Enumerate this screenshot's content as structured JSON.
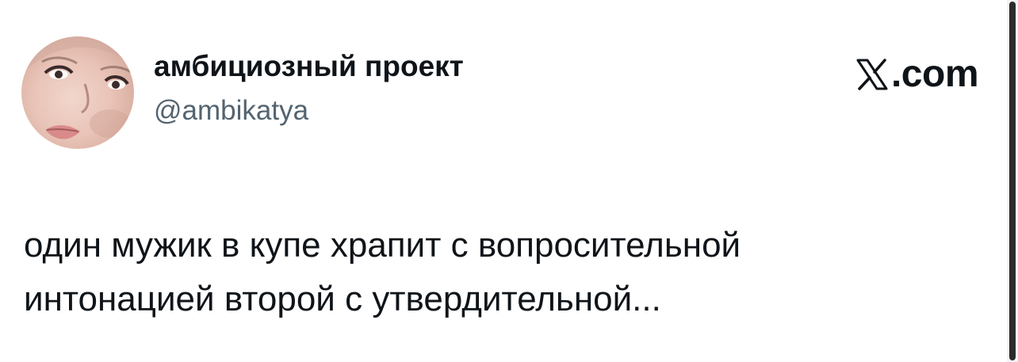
{
  "author": {
    "display_name": "амбициозный проект",
    "handle": "@ambikatya",
    "avatar_icon": "user-avatar-photo"
  },
  "brand": {
    "logo_icon": "x-logo-icon",
    "domain": ".com"
  },
  "tweet": {
    "text": "один мужик в купе храпит с вопросительной\nинтонацией второй с утвердительной..."
  },
  "colors": {
    "text_primary": "#0f1419",
    "text_secondary": "#536471",
    "background": "#ffffff"
  }
}
